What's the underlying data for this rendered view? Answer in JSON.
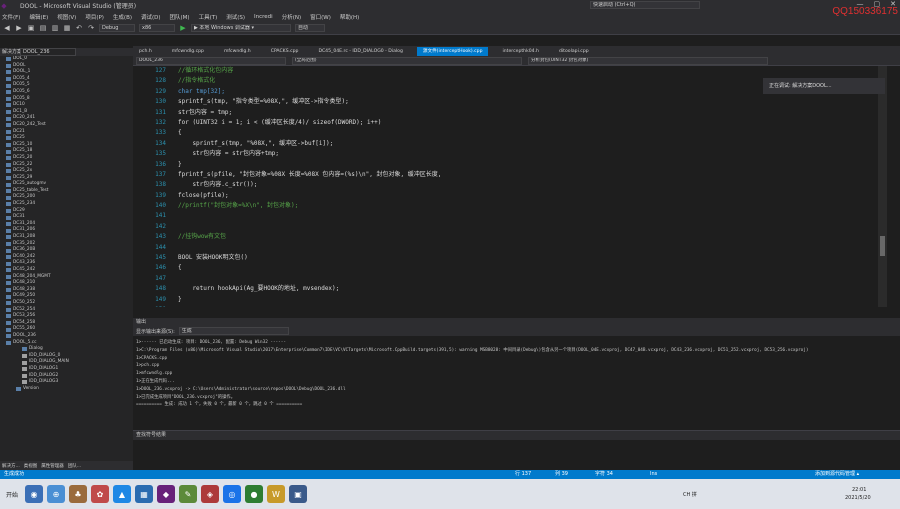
{
  "window": {
    "title": "DOOL - Microsoft Visual Studio (管理员)",
    "search_placeholder": "快速启动 (Ctrl+Q)",
    "watermark": "QQ150336175"
  },
  "menu": [
    "文件(F)",
    "编辑(E)",
    "视图(V)",
    "项目(P)",
    "生成(B)",
    "调试(D)",
    "团队(M)",
    "工具(T)",
    "测试(S)",
    "Incredi",
    "分析(N)",
    "窗口(W)",
    "帮助(H)"
  ],
  "toolbar": {
    "config": "Debug",
    "platform": "x86",
    "run_label": "▶ 本地 Windows 调试器 ▾",
    "auto": "自动"
  },
  "solution_explorer": {
    "title": "解决方案资源管理器",
    "search_value": "DOOL_236",
    "items": [
      "DOL_0",
      "DOOL",
      "DOOL_1",
      "DC05_4",
      "DC05_5",
      "DC05_6",
      "DC05_8",
      "DC10",
      "DC1_B",
      "DC20_241",
      "DC20_242_Test",
      "DC21",
      "DC25",
      "DC25_10",
      "DC25_18",
      "DC25_20",
      "DC25_22",
      "DC25_2x",
      "DC25_29",
      "DC25_autogmv",
      "DC25_table_Test",
      "DC25_200",
      "DC25_234",
      "DC29",
      "DC31",
      "DC31_204",
      "DC31_206",
      "DC31_208",
      "DC35_202",
      "DC36_20B",
      "DC40_242",
      "DC43_236",
      "DC45_242",
      "DC48_204_MGMT",
      "DC48_210",
      "DC48_238",
      "DC49_250",
      "DC50_252",
      "DC52_254",
      "DC53_256",
      "DC54_258",
      "DC55_260",
      "DOOL_236",
      "DOOL_5.cc",
      "Dialog",
      "IDD_DIALOG_0",
      "IDD_DIALOG_MAIN",
      "IDD_DIALOG1",
      "IDD_DIALOG2",
      "IDD_DIALOG3",
      "Version"
    ],
    "bottom_tabs": [
      "解决方...",
      "类视图",
      "属性管理器",
      "团队..."
    ]
  },
  "tabs": [
    "pch.h",
    "mfcwndlg.cpp",
    "mfcwndlg.h",
    "CPACKS.cpp",
    "DC45_04E.rc - IDD_DIALOG0 - Dialog",
    "源文件(interceptHook).cpp",
    "intercepthk04.h",
    "ditoolapi.cpp"
  ],
  "navbar": {
    "project": "DOOL_236",
    "scope": "(全局范围)",
    "member": "分析封包(UINT32 封包对象)"
  },
  "editor": {
    "lines": [
      {
        "n": "127",
        "t": "//循环格式化包内容",
        "cls": "cmt"
      },
      {
        "n": "128",
        "t": "//指令格式化",
        "cls": "cmt"
      },
      {
        "n": "129",
        "t": "char tmp[32];",
        "cls": "kw"
      },
      {
        "n": "130",
        "t": "sprintf_s(tmp, \"指令类型=%08X,\", 缓冲区->指令类型);",
        "cls": ""
      },
      {
        "n": "131",
        "t": "str包内容 = tmp;",
        "cls": ""
      },
      {
        "n": "132",
        "t": "for (UINT32 i = 1; i < (缓冲区长度/4)/ sizeof(DWORD); i++)",
        "cls": ""
      },
      {
        "n": "133",
        "t": "{",
        "cls": ""
      },
      {
        "n": "134",
        "t": "    sprintf_s(tmp, \"%08X,\", 缓冲区->buf[i]);",
        "cls": ""
      },
      {
        "n": "135",
        "t": "    str包内容 = str包内容+tmp;",
        "cls": ""
      },
      {
        "n": "136",
        "t": "}",
        "cls": ""
      },
      {
        "n": "137",
        "t": "fprintf_s(pfile, \"封包对象=%08X 长度=%08X 包内容=(%s)\\n\", 封包对象, 缓冲区长度,",
        "cls": ""
      },
      {
        "n": "138",
        "t": "    str包内容.c_str());",
        "cls": ""
      },
      {
        "n": "139",
        "t": "fclose(pfile);",
        "cls": ""
      },
      {
        "n": "140",
        "t": "//printf(\"封包对象=%X\\n\", 封包对象);",
        "cls": "cmt"
      },
      {
        "n": "141",
        "t": "",
        "cls": ""
      },
      {
        "n": "142",
        "t": "",
        "cls": ""
      },
      {
        "n": "143",
        "t": "//挂钩wow有文包",
        "cls": "cmt"
      },
      {
        "n": "144",
        "t": "",
        "cls": ""
      },
      {
        "n": "145",
        "t": "BOOL 安装HOOK明文包()",
        "cls": ""
      },
      {
        "n": "146",
        "t": "{",
        "cls": ""
      },
      {
        "n": "147",
        "t": "",
        "cls": ""
      },
      {
        "n": "148",
        "t": "    return hookApi(Ag_要HOOK的地址, mvsendex);",
        "cls": ""
      },
      {
        "n": "149",
        "t": "}",
        "cls": ""
      },
      {
        "n": "150",
        "t": "",
        "cls": ""
      }
    ]
  },
  "notification": "正在调试: 解决方案DOOL...",
  "output": {
    "title": "输出",
    "source_label": "显示输出来源(S):",
    "source_value": "生成",
    "lines": [
      "1>------ 已启动生成: 项目: DOOL_236, 配置: Debug Win32 ------",
      "1>C:\\Program Files (x86)\\Microsoft Visual Studio\\2017\\Enterprise\\Common7\\IDE\\VC\\VCTargets\\Microsoft.CppBuild.targets(391,5): warning MSB8028: 中间目录(Debug\\)包含从另一个项目(DOOL_04E.vcxproj, DC47_04B.vcxproj, DC43_236.vcxproj, DC51_252.vcxproj, DC53_256.vcxproj)",
      "1>CPACKS.cpp",
      "1>pch.cpp",
      "1>mfcwndlg.cpp",
      "1>正在生成代码...",
      "1>DOOL_236.vcxproj -> C:\\Users\\Administrator\\source\\repos\\DOOL\\Debug\\DOOL_236.dll",
      "1>已完成生成项目\"DOOL_236.vcxproj\"的操作。",
      "========== 生成: 成功 1 个，失败 0 个，最新 0 个，跳过 0 个 =========="
    ]
  },
  "error_list": {
    "title": "查找符号结果"
  },
  "status": {
    "left": "生成成功",
    "pos": "行 137",
    "col": "列 39",
    "ch": "字符 34",
    "ins": "Ins",
    "right": "添加到源代码管理 ▴"
  },
  "taskbar": {
    "start": "开始",
    "time": "22:01",
    "date": "2021/5/20",
    "ime": "CH 拼"
  }
}
